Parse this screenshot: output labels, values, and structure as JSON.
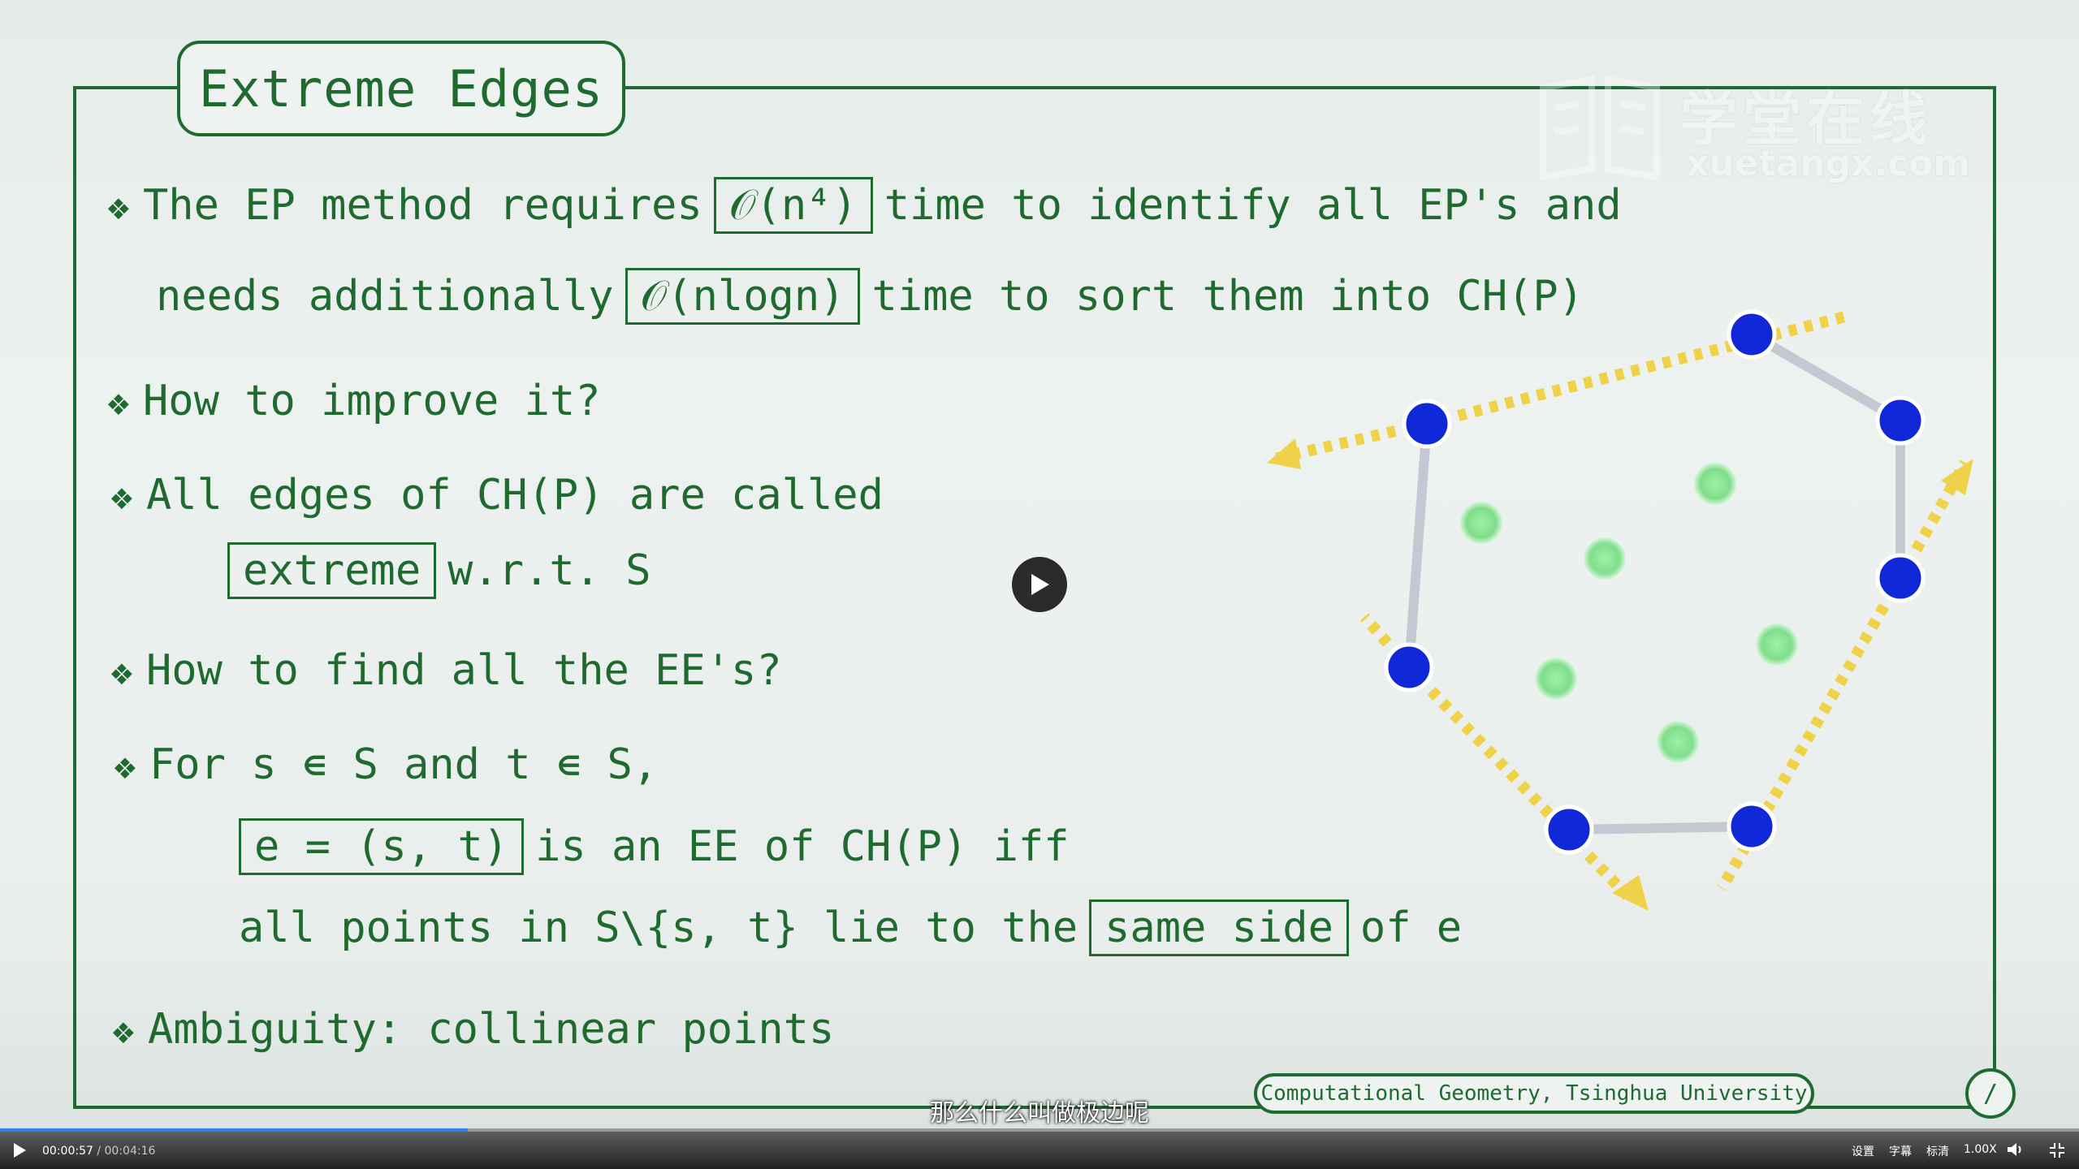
{
  "slide": {
    "title": "Extreme Edges",
    "watermark": {
      "cn": "学堂在线",
      "en": "xuetangx.com"
    },
    "bullets": [
      {
        "line1_a": "The EP method requires",
        "line1_box": "𝒪(n⁴)",
        "line1_b": "time to identify all EP's and",
        "line2_a": "needs additionally",
        "line2_box": "𝒪(nlogn)",
        "line2_b": "time to sort them into CH(P)"
      },
      {
        "text": "How to improve it?"
      },
      {
        "text": "All edges of CH(P) are called",
        "sub_box": "extreme",
        "sub_rest": "w.r.t. S"
      },
      {
        "text": "How to find all the EE's?"
      },
      {
        "text": "For s ∊ S and t ∊ S,",
        "sub1_box": "e = (s, t)",
        "sub1_rest": "is an EE of CH(P)  iff",
        "sub2_a": "all points in S\\{s, t} lie to the",
        "sub2_box": "same side",
        "sub2_b": "of e"
      },
      {
        "text": "Ambiguity: collinear points"
      }
    ],
    "footer": "Computational Geometry, Tsinghua University",
    "page_badge": "/"
  },
  "subtitle": "那么什么叫做极边呢",
  "player": {
    "current_time": "00:00:57",
    "duration": "00:04:16",
    "progress": 0.225,
    "buttons": {
      "settings": "设置",
      "captions": "字幕",
      "quality": "标清",
      "speed": "1.00X"
    }
  },
  "colors": {
    "slide_green": "#1f6b2f",
    "hull_point": "#1028d8",
    "inner_point": "#8ee89a",
    "arrow": "#f0d24a"
  },
  "icons": [
    "play-icon",
    "play-overlay-icon",
    "volume-icon",
    "fullscreen-exit-icon",
    "bullet-diamond-icon"
  ]
}
